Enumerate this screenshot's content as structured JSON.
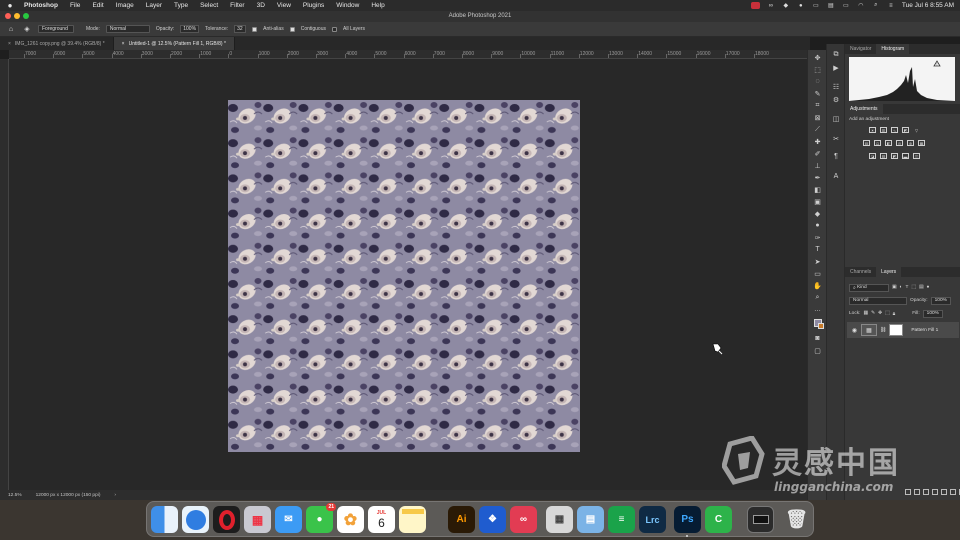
{
  "menubar": {
    "app": "Photoshop",
    "items": [
      "File",
      "Edit",
      "Image",
      "Layer",
      "Type",
      "Select",
      "Filter",
      "3D",
      "View",
      "Plugins",
      "Window",
      "Help"
    ],
    "clock": "Tue Jul 6  8:55 AM"
  },
  "window": {
    "title": "Adobe Photoshop 2021"
  },
  "options": {
    "fill_source": "Foreground",
    "mode_label": "Mode:",
    "mode_value": "Normal",
    "opacity_label": "Opacity:",
    "opacity_value": "100%",
    "tolerance_label": "Tolerance:",
    "tolerance_value": "32",
    "anti_alias_label": "Anti-alias",
    "contiguous_label": "Contiguous",
    "all_layers_label": "All Layers"
  },
  "tabs": [
    {
      "label": "IMG_1261 copy.png @ 39.4% (RGB/8) *"
    },
    {
      "label": "Untitled-1 @ 12.5% (Pattern Fill 1, RGB/8) *"
    }
  ],
  "ruler_h": [
    "7000",
    "6000",
    "5000",
    "4000",
    "3000",
    "2000",
    "1000",
    "0",
    "1000",
    "2000",
    "3000",
    "4000",
    "5000",
    "6000",
    "7000",
    "8000",
    "9000",
    "10000",
    "11000",
    "12000",
    "13000",
    "14000",
    "15000",
    "16000",
    "17000",
    "18000"
  ],
  "status": {
    "zoom": "12.5%",
    "doc_size": "12000 px x 12000 px (150 ppi)"
  },
  "panels": {
    "top_tabs": [
      "Navigator",
      "Histogram"
    ],
    "adjustments_title": "Adjustments",
    "adjustments_hint": "Add an adjustment",
    "layer_tabs": [
      "Channels",
      "Layers"
    ],
    "kind_label": "Kind",
    "blend_mode": "Normal",
    "opacity_label": "Opacity:",
    "opacity_value": "100%",
    "lock_label": "Lock:",
    "fill_label": "Fill:",
    "fill_value": "100%",
    "layer_name": "Pattern Fill 1"
  },
  "watermark": {
    "cn": "灵感中国",
    "en": "lingganchina.com"
  },
  "dock": {
    "calendar_month": "JUL",
    "calendar_day": "6",
    "messages_badge": "21",
    "apps": [
      "finder-icon",
      "safari-icon",
      "opera-icon",
      "launchpad-icon",
      "mail-icon",
      "messages-icon",
      "photos-icon",
      "calendar-icon",
      "notes-icon",
      "illustrator-icon",
      "dropbox-icon",
      "creative-cloud-icon",
      "calculator-icon",
      "preview-icon",
      "sheets-icon",
      "lightroom-classic-icon",
      "photoshop-icon",
      "camtasia-icon",
      "screen-icon",
      "trash-icon"
    ],
    "labels": {
      "illustrator": "Ai",
      "lightroom": "Lrc",
      "photoshop": "Ps"
    }
  },
  "colors": {
    "app_bg": "#282828",
    "panel_bg": "#383838",
    "pattern_base": "#8e8aa3"
  }
}
